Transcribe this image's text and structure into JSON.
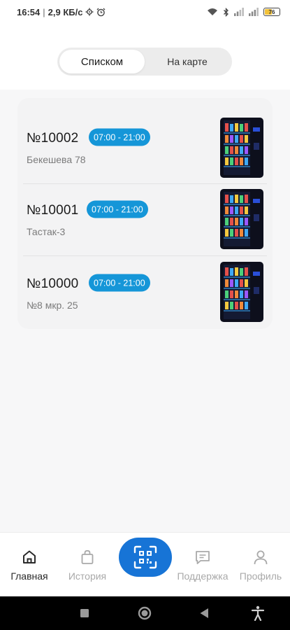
{
  "status_bar": {
    "time": "16:54",
    "separator": "|",
    "speed": "2,9 КБ/с",
    "battery_level": "76",
    "icons": [
      "settings-gear-icon",
      "alarm-icon",
      "wifi-icon",
      "bluetooth-icon",
      "signal-icon",
      "signal-icon",
      "battery-icon"
    ]
  },
  "view_toggle": {
    "list_label": "Списком",
    "map_label": "На карте",
    "active": "list"
  },
  "machines": [
    {
      "number": "№10002",
      "hours": "07:00 - 21:00",
      "address": "Бекешева 78",
      "image": "vending-machine-photo"
    },
    {
      "number": "№10001",
      "hours": "07:00 - 21:00",
      "address": "Тастак-3",
      "image": "vending-machine-photo"
    },
    {
      "number": "№10000",
      "hours": "07:00 - 21:00",
      "address": "№8 мкр. 25",
      "image": "vending-machine-photo"
    }
  ],
  "bottom_nav": {
    "home_label": "Главная",
    "history_label": "История",
    "support_label": "Поддержка",
    "profile_label": "Профиль",
    "scan_icon": "qr-scan-icon",
    "active": "home"
  },
  "system_nav": {
    "icons": [
      "recents-square-icon",
      "home-circle-icon",
      "back-triangle-icon",
      "accessibility-icon"
    ]
  },
  "colors": {
    "accent": "#1774d6",
    "hours_badge": "#1596d8",
    "card_bg": "#f3f3f4",
    "inactive_text": "#a9a9a9"
  }
}
